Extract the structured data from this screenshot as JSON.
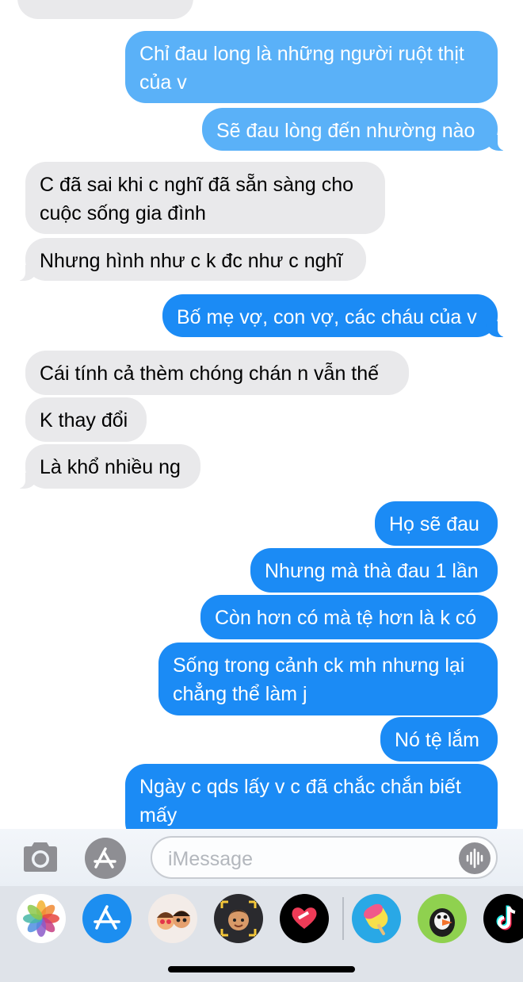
{
  "conversation": {
    "partial_top": "",
    "messages": [
      {
        "side": "out",
        "text": "Chỉ đau long là những người ruột thịt\ncủa v"
      },
      {
        "side": "out",
        "text": "Sẽ đau lòng đến nhường nào"
      },
      {
        "side": "in",
        "text": "C đã sai khi c nghĩ đã sẵn sàng cho\ncuộc sống gia đình"
      },
      {
        "side": "in",
        "text": "Nhưng hình như c k đc như c nghĩ"
      },
      {
        "side": "out",
        "text": "Bố mẹ vợ, con vợ, các cháu của v"
      },
      {
        "side": "in",
        "text": "Cái tính cả thèm chóng chán n vẫn thế"
      },
      {
        "side": "in",
        "text": "K thay đổi"
      },
      {
        "side": "in",
        "text": "Là khổ nhiều ng"
      },
      {
        "side": "out",
        "text": "Họ sẽ đau"
      },
      {
        "side": "out",
        "text": "Nhưng mà thà đau 1 lần"
      },
      {
        "side": "out",
        "text": "Còn hơn có mà tệ hơn là k có"
      },
      {
        "side": "out",
        "text": "Sống trong cảnh ck mh nhưng lại\nchẳng thể làm j"
      },
      {
        "side": "out",
        "text": "Nó tệ lắm"
      },
      {
        "side": "out",
        "text": "Ngày c qds lấy v c đã chắc chắn biết\nmấy"
      }
    ]
  },
  "input_bar": {
    "placeholder": "iMessage",
    "camera_icon": "camera-icon",
    "apps_icon": "app-store-icon",
    "audio_icon": "waveform-icon"
  },
  "app_drawer": {
    "apps": [
      "photos",
      "app-store",
      "memoji-stickers",
      "memoji",
      "digital-touch",
      "ice-cream-stickers",
      "puffin-stickers",
      "tiktok"
    ]
  },
  "colors": {
    "outgoing": "#1b8bf5",
    "outgoing_light": "#5ab1f8",
    "incoming": "#e9e9eb"
  }
}
